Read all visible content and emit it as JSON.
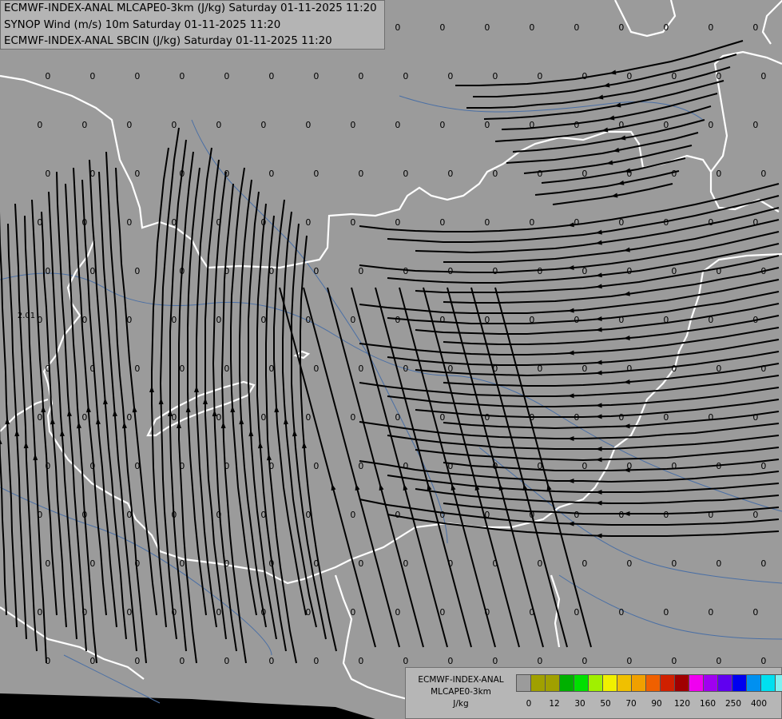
{
  "title_lines": [
    "ECMWF-INDEX-ANAL MLCAPE0-3km (J/kg) Saturday 01-11-2025 11:20",
    "SYNOP Wind (m/s) 10m Saturday 01-11-2025 11:20",
    "ECMWF-INDEX-ANAL SBCIN (J/kg) Saturday 01-11-2025 11:20"
  ],
  "legend": {
    "title_lines": [
      "ECMWF-INDEX-ANAL",
      "MLCAPE0-3km",
      "J/kg"
    ],
    "colors": [
      "#9b9b9b",
      "#a0a000",
      "#a0a000",
      "#00b000",
      "#00e000",
      "#a0f000",
      "#f0f000",
      "#f0c000",
      "#f0a000",
      "#f06000",
      "#d02000",
      "#a00000",
      "#f000f0",
      "#a000f0",
      "#6000f0",
      "#0000f0",
      "#0090f0",
      "#00e0f0",
      "#80f0f0",
      "#ffffff"
    ],
    "tick_labels": [
      "0",
      "12",
      "30",
      "50",
      "70",
      "90",
      "120",
      "160",
      "250",
      "400"
    ]
  },
  "value_label": "0",
  "extra_label": "2.01"
}
